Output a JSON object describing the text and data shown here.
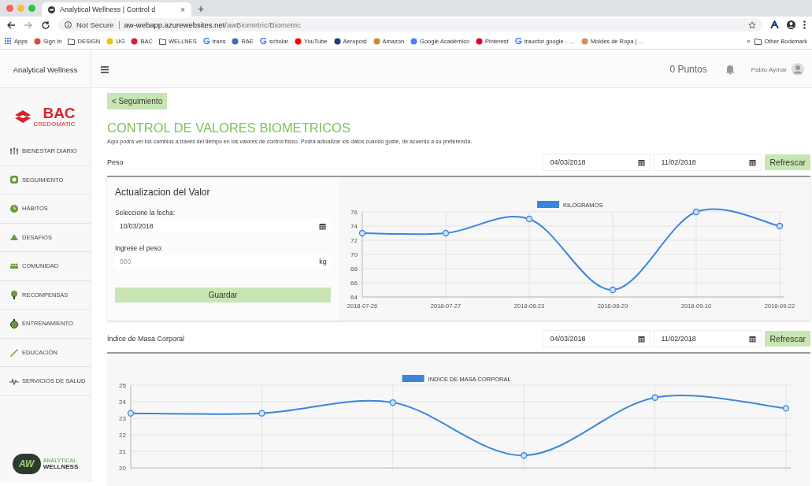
{
  "browser": {
    "tab_title": "Analytical Wellness | Control d",
    "tab_close": "×",
    "new_tab": "+",
    "security": "Not Secure",
    "url_host": "aw-webapp.azurewebsites.net",
    "url_path": "/awBiometric/Biometric",
    "bookmarks": [
      {
        "label": "Apps",
        "kind": "apps"
      },
      {
        "label": "Sign In",
        "kind": "site",
        "color": "#e8453c"
      },
      {
        "label": "DESIGN",
        "kind": "folder"
      },
      {
        "label": "UG",
        "kind": "site",
        "color": "#f4c20d"
      },
      {
        "label": "BAC",
        "kind": "site",
        "color": "#d9232d"
      },
      {
        "label": "WELLNES",
        "kind": "folder"
      },
      {
        "label": "trans",
        "kind": "google"
      },
      {
        "label": "RAE",
        "kind": "site",
        "color": "#3b6fb6"
      },
      {
        "label": "scholar",
        "kind": "google"
      },
      {
        "label": "YouTube",
        "kind": "site",
        "color": "#ff0000"
      },
      {
        "label": "Aeropost",
        "kind": "site",
        "color": "#1a3d8f"
      },
      {
        "label": "Amazon",
        "kind": "site",
        "color": "#c78a2c"
      },
      {
        "label": "Google Académico",
        "kind": "site",
        "color": "#4285f4"
      },
      {
        "label": "Pinterest",
        "kind": "site",
        "color": "#e60023"
      },
      {
        "label": "trauctor google - …",
        "kind": "google"
      },
      {
        "label": "Moldes de Ropa | …",
        "kind": "site",
        "color": "#d98c5f"
      }
    ],
    "more": "»",
    "other_bookmarks": "Other Bookmark"
  },
  "app": {
    "brand": "Analytical Wellness",
    "points": "0 Puntos",
    "user": "Pablo Aymar"
  },
  "sidebar": {
    "logo_text": "BAC",
    "logo_subtext": "CREDOMATIC",
    "items": [
      {
        "label": "BIENESTAR DIARIO"
      },
      {
        "label": "SEGUIMIENTO"
      },
      {
        "label": "HÁBITOS"
      },
      {
        "label": "DESAFIOS"
      },
      {
        "label": "COMUNIDAD"
      },
      {
        "label": "RECOMPENSAS"
      },
      {
        "label": "ENTRENAMIENTO"
      },
      {
        "label": "EDUCACIÓN"
      },
      {
        "label": "SERVICIOS DE SALUD"
      }
    ],
    "footer_logo": {
      "mark": "AW",
      "line1": "ANALYTICAL",
      "line2": "WELLNESS"
    }
  },
  "page": {
    "back": "< Seguimiento",
    "title": "CONTROL DE VALORES BIOMETRICOS",
    "description": "Aquí podrá ver los cambios a través del tiempo en los valores de control físico. Podrá actualizar los datos cuando guste, de acuerdo a su preferencia."
  },
  "sections": [
    {
      "label": "Peso",
      "date_from": "04/03/2018",
      "date_to": "11/02/2018",
      "refresh": "Refrescar",
      "form": {
        "title": "Actualizacion del Valor",
        "date_label": "Seleccione la fecha:",
        "date_value": "10/03/2018",
        "value_label": "Ingrese el peso:",
        "value_placeholder": "000",
        "unit": "kg",
        "submit": "Guardar"
      },
      "chart_data": {
        "type": "line",
        "categories": [
          "2018-07-26",
          "2018-07-27",
          "2018-08-23",
          "2018-08-29",
          "2018-09-10",
          "2018-09-22"
        ],
        "ylim": [
          64,
          76
        ],
        "yticks": [
          64,
          66,
          68,
          70,
          72,
          74,
          76
        ],
        "grid": true,
        "series": [
          {
            "name": "KILOGRAMOS",
            "color": "#3a86dc",
            "marker": true,
            "values": [
              73,
              73,
              75,
              65,
              76,
              74
            ]
          }
        ]
      }
    },
    {
      "label": "Índice de Masa Corporal",
      "date_from": "04/03/2018",
      "date_to": "11/02/2018",
      "refresh": "Refrescar",
      "chart_data": {
        "type": "line",
        "ylim": [
          20,
          25
        ],
        "yticks": [
          20,
          21,
          22,
          23,
          24,
          25
        ],
        "grid": true,
        "series": [
          {
            "name": "INDICE DE MASA CORPORAL",
            "color": "#3a86dc",
            "marker": true,
            "values": [
              23.3,
              23.3,
              23.95,
              20.75,
              24.25,
              23.6
            ]
          }
        ]
      }
    }
  ]
}
